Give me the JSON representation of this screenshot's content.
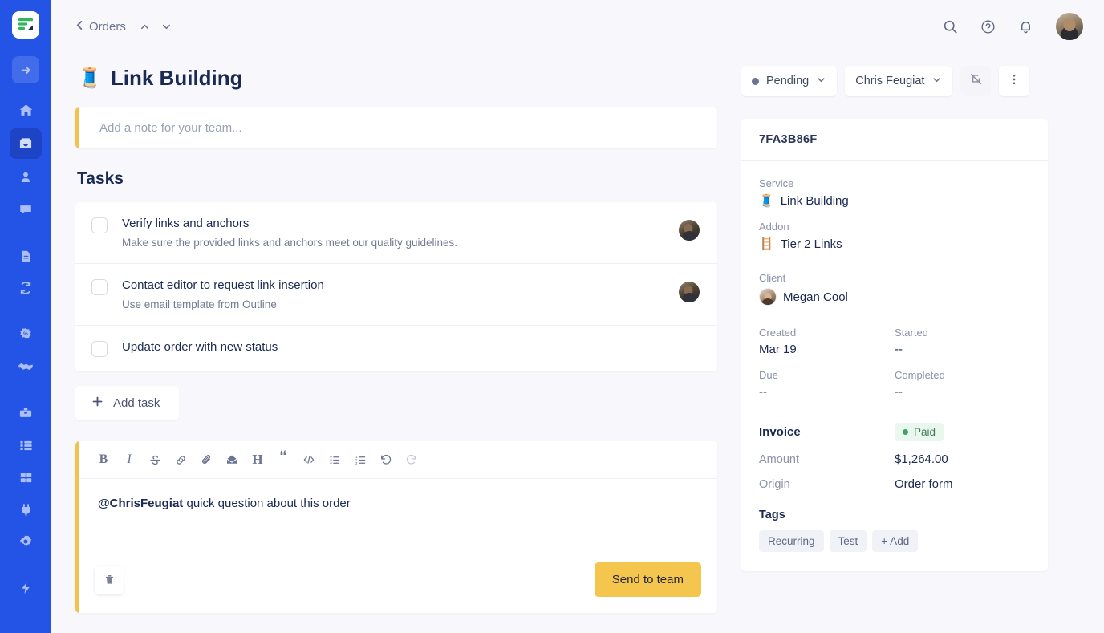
{
  "sidebar": {
    "logo": "logo-icon",
    "items": [
      {
        "icon": "arrow-right-box-icon",
        "name": "sidebar-item-arrow-right",
        "active": false,
        "boxed": true
      },
      {
        "icon": "home-icon",
        "name": "sidebar-item-home",
        "active": false,
        "boxed": false
      },
      {
        "icon": "inbox-icon",
        "name": "sidebar-item-inbox",
        "active": true,
        "boxed": false
      },
      {
        "icon": "user-icon",
        "name": "sidebar-item-clients",
        "active": false,
        "boxed": false
      },
      {
        "icon": "chat-icon",
        "name": "sidebar-item-messages",
        "active": false,
        "boxed": false
      },
      {
        "icon": "document-icon",
        "name": "sidebar-item-documents",
        "active": false,
        "boxed": false
      },
      {
        "icon": "refresh-icon",
        "name": "sidebar-item-subscriptions",
        "active": false,
        "boxed": false
      },
      {
        "icon": "discount-icon",
        "name": "sidebar-item-coupons",
        "active": false,
        "boxed": false
      },
      {
        "icon": "handshake-icon",
        "name": "sidebar-item-affiliates",
        "active": false,
        "boxed": false
      },
      {
        "icon": "toolbox-icon",
        "name": "sidebar-item-services",
        "active": false,
        "boxed": false
      },
      {
        "icon": "list-icon",
        "name": "sidebar-item-forms",
        "active": false,
        "boxed": false
      },
      {
        "icon": "grid-icon",
        "name": "sidebar-item-apps",
        "active": false,
        "boxed": false
      },
      {
        "icon": "plug-icon",
        "name": "sidebar-item-integrations",
        "active": false,
        "boxed": false
      },
      {
        "icon": "gear-icon",
        "name": "sidebar-item-settings",
        "active": false,
        "boxed": false
      },
      {
        "icon": "bolt-icon",
        "name": "sidebar-item-automations",
        "active": false,
        "boxed": false
      }
    ]
  },
  "topbar": {
    "breadcrumb_label": "Orders",
    "back_icon": "chevron-left-icon",
    "prev_icon": "chevron-up-icon",
    "next_icon": "chevron-down-icon",
    "search_icon": "search-icon",
    "help_icon": "help-circle-icon",
    "notifications_icon": "bell-icon",
    "avatar": "user-avatar"
  },
  "page": {
    "title": "Link Building",
    "title_emoji": "🧵",
    "note_placeholder": "Add a note for your team...",
    "tasks_heading": "Tasks"
  },
  "tasks": [
    {
      "title": "Verify links and anchors",
      "desc": "Make sure the provided links and anchors meet our quality guidelines.",
      "checked": false,
      "has_assignee": true
    },
    {
      "title": "Contact editor to request link insertion",
      "desc": "Use email template from Outline",
      "checked": false,
      "has_assignee": true
    },
    {
      "title": "Update order with new status",
      "desc": "",
      "checked": false,
      "has_assignee": false
    }
  ],
  "add_task_label": "Add task",
  "add_task_icon": "plus-icon",
  "editor": {
    "toolbar": [
      {
        "label": "B",
        "name": "bold-icon"
      },
      {
        "label": "I",
        "name": "italic-icon"
      },
      {
        "label": "S",
        "name": "strikethrough-icon"
      },
      {
        "label": "link",
        "name": "link-icon"
      },
      {
        "label": "attach",
        "name": "paperclip-icon"
      },
      {
        "label": "email",
        "name": "envelope-icon"
      },
      {
        "label": "H",
        "name": "heading-icon"
      },
      {
        "label": "quote",
        "name": "blockquote-icon"
      },
      {
        "label": "code",
        "name": "code-icon"
      },
      {
        "label": "ul",
        "name": "bullet-list-icon"
      },
      {
        "label": "ol",
        "name": "numbered-list-icon"
      },
      {
        "label": "undo",
        "name": "undo-icon"
      },
      {
        "label": "redo",
        "name": "redo-icon"
      }
    ],
    "mention": "@ChrisFeugiat",
    "body_text": " quick question about this order",
    "delete_icon": "trash-icon",
    "send_label": "Send to team"
  },
  "right": {
    "status_label": "Pending",
    "status_dot_color": "#6b7490",
    "assignee_label": "Chris Feugiat",
    "mute_icon": "bell-off-icon",
    "more_icon": "more-vertical-icon",
    "order_id": "7FA3B86F",
    "service_label": "Service",
    "service_value": "Link Building",
    "service_emoji": "🧵",
    "addon_label": "Addon",
    "addon_value": "Tier 2 Links",
    "addon_emoji": "🪜",
    "client_label": "Client",
    "client_value": "Megan Cool",
    "created_label": "Created",
    "created_value": "Mar 19",
    "started_label": "Started",
    "started_value": "--",
    "due_label": "Due",
    "due_value": "--",
    "completed_label": "Completed",
    "completed_value": "--",
    "invoice_label": "Invoice",
    "invoice_status": "Paid",
    "amount_label": "Amount",
    "amount_value": "$1,264.00",
    "origin_label": "Origin",
    "origin_value": "Order form",
    "tags_label": "Tags",
    "tags": [
      "Recurring",
      "Test"
    ],
    "tag_add_label": "+ Add"
  },
  "colors": {
    "sidebar": "#2354e6",
    "sidebar_active": "#1c44c4",
    "accent_yellow": "#f4c64e",
    "background": "#f8f8fc",
    "text_dark": "#1b2a52",
    "paid_green": "#3fa45f"
  }
}
